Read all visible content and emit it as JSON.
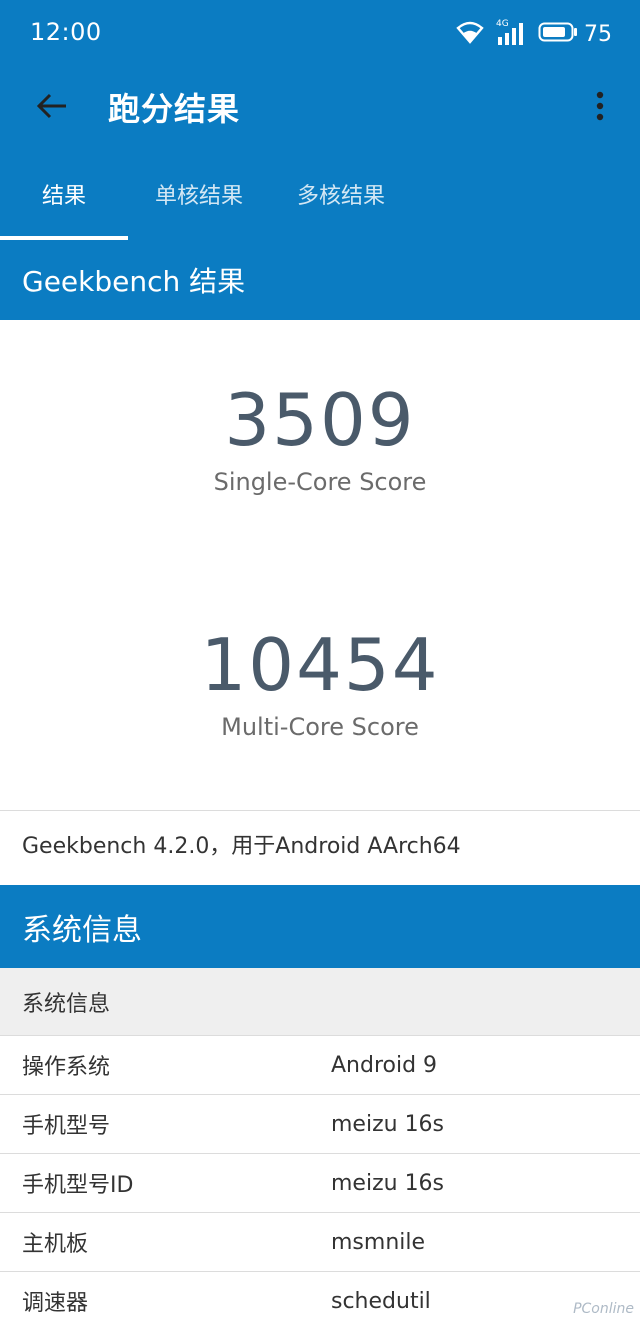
{
  "status_bar": {
    "time": "12:00",
    "network": "4G",
    "battery": "75"
  },
  "app_bar": {
    "title": "跑分结果"
  },
  "tabs": [
    {
      "label": "结果",
      "active": true
    },
    {
      "label": "单核结果",
      "active": false
    },
    {
      "label": "多核结果",
      "active": false
    }
  ],
  "results": {
    "header": "Geekbench 结果",
    "single_core_score": "3509",
    "single_core_label": "Single-Core Score",
    "multi_core_score": "10454",
    "multi_core_label": "Multi-Core Score",
    "version": "Geekbench 4.2.0，用于Android AArch64"
  },
  "system_info": {
    "header": "系统信息",
    "subheader": "系统信息",
    "rows": [
      {
        "key": "操作系统",
        "value": "Android 9"
      },
      {
        "key": "手机型号",
        "value": "meizu 16s"
      },
      {
        "key": "手机型号ID",
        "value": "meizu 16s"
      },
      {
        "key": "主机板",
        "value": "msmnile"
      },
      {
        "key": "调速器",
        "value": "schedutil"
      }
    ]
  },
  "watermark": "PConline",
  "colors": {
    "primary": "#0b7cc2",
    "score_text": "#4a5a6a",
    "divider": "#dcdcdc",
    "subheader_bg": "#efefef"
  }
}
